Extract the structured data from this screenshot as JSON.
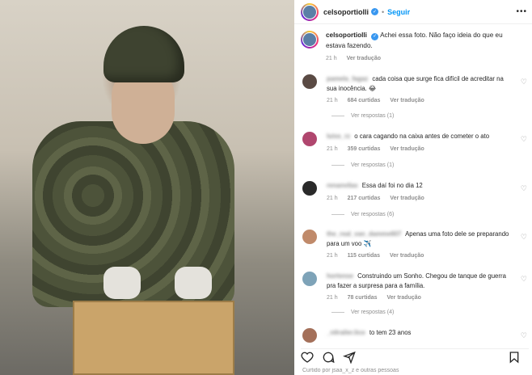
{
  "post": {
    "author": "celsoportiolli",
    "follow_label": "Seguir",
    "caption_user": "celsoportiolli",
    "caption_text": "Achei essa foto. Não faço ideia do que eu estava fazendo.",
    "caption_time": "21 h",
    "caption_translate": "Ver tradução"
  },
  "comments": [
    {
      "user": "pamela_fagaz",
      "text": "cada coisa que surge fica difícil de acreditar na sua inocência. 😂",
      "time": "21 h",
      "likes": "684 curtidas",
      "translate": "Ver tradução",
      "replies": "Ver respostas (1)",
      "avatar_color": "#5a4a44"
    },
    {
      "user": "luiss_rz",
      "text": "o cara cagando na caixa antes de cometer o ato",
      "time": "21 h",
      "likes": "359 curtidas",
      "translate": "Ver tradução",
      "replies": "Ver respostas (1)",
      "avatar_color": "#b0466e"
    },
    {
      "user": "renanvilas",
      "text": "Essa daí foi no dia 12",
      "time": "21 h",
      "likes": "217 curtidas",
      "translate": "Ver tradução",
      "replies": "Ver respostas (6)",
      "avatar_color": "#2a2a2a"
    },
    {
      "user": "the_real_van_damme607",
      "text": "Apenas uma foto dele se preparando para um voo ✈️",
      "time": "21 h",
      "likes": "115 curtidas",
      "translate": "Ver tradução",
      "replies": "",
      "avatar_color": "#c08a6a"
    },
    {
      "user": "hortense",
      "text": "Construindo um Sonho. Chegou de tanque de guerra pra fazer a surpresa para a família.",
      "time": "21 h",
      "likes": "78 curtidas",
      "translate": "Ver tradução",
      "replies": "Ver respostas (4)",
      "avatar_color": "#7ea3b8"
    },
    {
      "user": "_nilrailer.lico",
      "text": "to tem 23 anos",
      "time": "",
      "likes": "",
      "translate": "",
      "replies": "",
      "avatar_color": "#a4705a"
    }
  ],
  "footer": {
    "likes_text": "Curtido por jsaa_x_z e outras pessoas"
  },
  "icons": {
    "verified": "verified-badge-icon",
    "more": "more-options-icon",
    "heart": "heart-icon",
    "comment": "comment-icon",
    "share": "share-icon",
    "bookmark": "bookmark-icon"
  },
  "colors": {
    "link": "#0095f6",
    "muted": "#8e8e8e",
    "verified": "#3897f0"
  }
}
